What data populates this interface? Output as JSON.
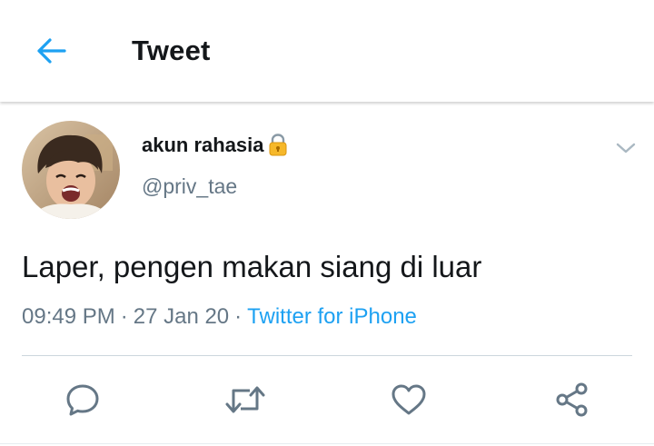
{
  "header": {
    "title": "Tweet",
    "back_icon": "arrow-left-icon",
    "accent_color": "#1da1f2"
  },
  "tweet": {
    "display_name": "akun rahasia",
    "protected_icon": "lock-icon",
    "username": "@priv_tae",
    "text": "Laper, pengen makan siang di luar",
    "time": "09:49 PM",
    "separator": "·",
    "date": "27 Jan 20",
    "source": "Twitter for iPhone",
    "menu_icon": "chevron-down-icon"
  },
  "actions": [
    {
      "icon": "reply-icon"
    },
    {
      "icon": "retweet-icon"
    },
    {
      "icon": "like-icon"
    },
    {
      "icon": "share-icon"
    }
  ],
  "colors": {
    "text_primary": "#14171a",
    "text_secondary": "#657786",
    "link": "#1da1f2",
    "divider": "#ccd6dd"
  }
}
